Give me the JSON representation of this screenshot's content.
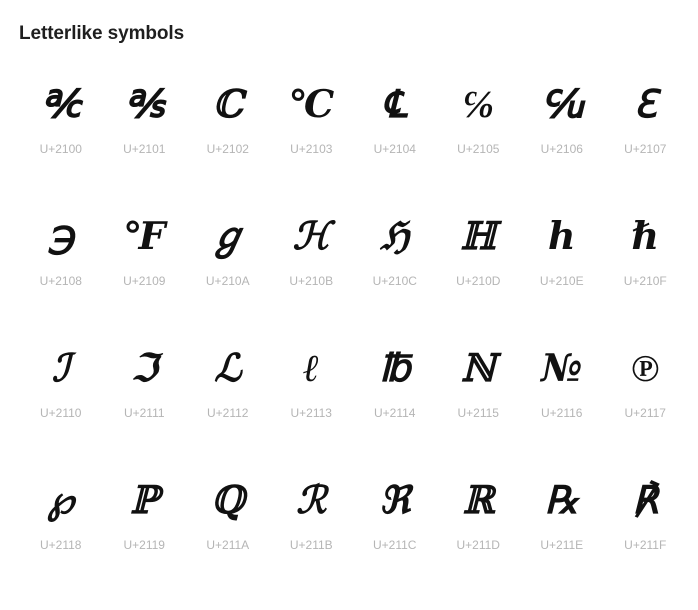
{
  "section": {
    "title": "Letterlike symbols"
  },
  "glyphs": [
    {
      "char": "℀",
      "code": "U+2100"
    },
    {
      "char": "℁",
      "code": "U+2101"
    },
    {
      "char": "ℂ",
      "code": "U+2102"
    },
    {
      "char": "℃",
      "code": "U+2103"
    },
    {
      "char": "℄",
      "code": "U+2104"
    },
    {
      "char": "℅",
      "code": "U+2105"
    },
    {
      "char": "℆",
      "code": "U+2106"
    },
    {
      "char": "ℇ",
      "code": "U+2107"
    },
    {
      "char": "℈",
      "code": "U+2108"
    },
    {
      "char": "℉",
      "code": "U+2109"
    },
    {
      "char": "ℊ",
      "code": "U+210A"
    },
    {
      "char": "ℋ",
      "code": "U+210B"
    },
    {
      "char": "ℌ",
      "code": "U+210C"
    },
    {
      "char": "ℍ",
      "code": "U+210D"
    },
    {
      "char": "ℎ",
      "code": "U+210E"
    },
    {
      "char": "ℏ",
      "code": "U+210F"
    },
    {
      "char": "ℐ",
      "code": "U+2110"
    },
    {
      "char": "ℑ",
      "code": "U+2111"
    },
    {
      "char": "ℒ",
      "code": "U+2112"
    },
    {
      "char": "ℓ",
      "code": "U+2113"
    },
    {
      "char": "℔",
      "code": "U+2114"
    },
    {
      "char": "ℕ",
      "code": "U+2115"
    },
    {
      "char": "№",
      "code": "U+2116"
    },
    {
      "char": "℗",
      "code": "U+2117"
    },
    {
      "char": "℘",
      "code": "U+2118"
    },
    {
      "char": "ℙ",
      "code": "U+2119"
    },
    {
      "char": "ℚ",
      "code": "U+211A"
    },
    {
      "char": "ℛ",
      "code": "U+211B"
    },
    {
      "char": "ℜ",
      "code": "U+211C"
    },
    {
      "char": "ℝ",
      "code": "U+211D"
    },
    {
      "char": "℞",
      "code": "U+211E"
    },
    {
      "char": "℟",
      "code": "U+211F"
    }
  ],
  "colors": {
    "background": "#ffffff",
    "title": "#1f1f1f",
    "glyph": "#111111",
    "code_label": "#b5b5b5"
  }
}
